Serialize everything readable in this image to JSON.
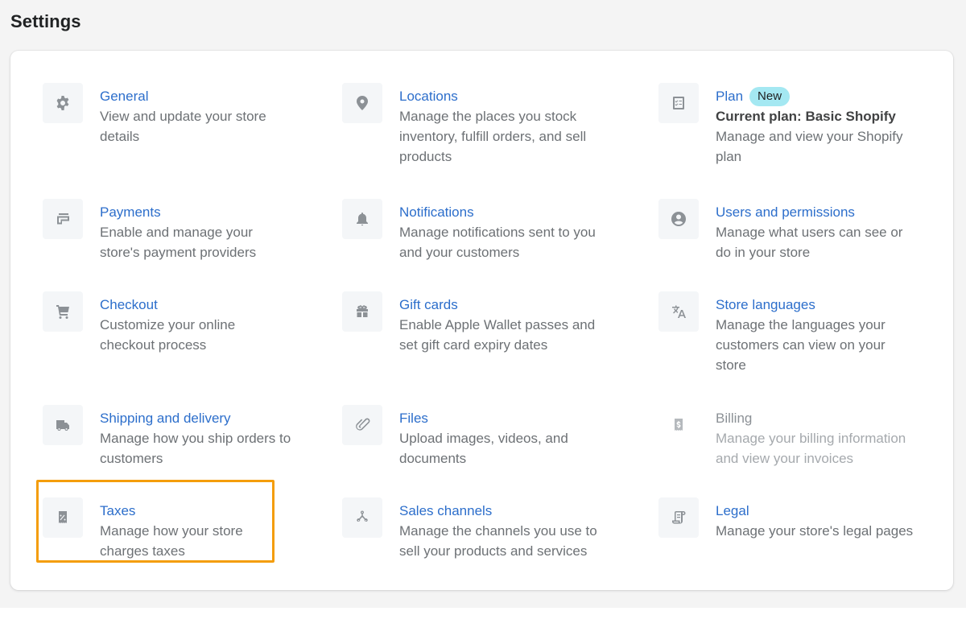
{
  "page": {
    "title": "Settings"
  },
  "highlight": {
    "target": "taxes",
    "color": "#f49d0c"
  },
  "colors": {
    "link": "#2c6ecb",
    "badge_bg": "#a4e8f2",
    "icon": "#8c9196"
  },
  "settings": {
    "general": {
      "icon": "gear-icon",
      "title": "General",
      "description": "View and update your store details"
    },
    "locations": {
      "icon": "location-pin-icon",
      "title": "Locations",
      "description": "Manage the places you stock inventory, fulfill orders, and sell products"
    },
    "plan": {
      "icon": "checklist-icon",
      "title": "Plan",
      "badge": "New",
      "subtitle": "Current plan: Basic Shopify",
      "description": "Manage and view your Shopify plan"
    },
    "payments": {
      "icon": "payment-card-icon",
      "title": "Payments",
      "description": "Enable and manage your store's payment providers"
    },
    "notifications": {
      "icon": "bell-icon",
      "title": "Notifications",
      "description": "Manage notifications sent to you and your customers"
    },
    "users": {
      "icon": "user-circle-icon",
      "title": "Users and permissions",
      "description": "Manage what users can see or do in your store"
    },
    "checkout": {
      "icon": "cart-icon",
      "title": "Checkout",
      "description": "Customize your online checkout process"
    },
    "gift_cards": {
      "icon": "gift-icon",
      "title": "Gift cards",
      "description": "Enable Apple Wallet passes and set gift card expiry dates"
    },
    "languages": {
      "icon": "translate-icon",
      "title": "Store languages",
      "description": "Manage the languages your customers can view on your store"
    },
    "shipping": {
      "icon": "truck-icon",
      "title": "Shipping and delivery",
      "description": "Manage how you ship orders to customers"
    },
    "files": {
      "icon": "paperclip-icon",
      "title": "Files",
      "description": "Upload images, videos, and documents"
    },
    "billing": {
      "icon": "dollar-receipt-icon",
      "title": "Billing",
      "description": "Manage your billing information and view your invoices",
      "disabled": true
    },
    "taxes": {
      "icon": "tax-receipt-icon",
      "title": "Taxes",
      "description": "Manage how your store charges taxes"
    },
    "sales_channels": {
      "icon": "channels-icon",
      "title": "Sales channels",
      "description": "Manage the channels you use to sell your products and services"
    },
    "legal": {
      "icon": "scroll-icon",
      "title": "Legal",
      "description": "Manage your store's legal pages"
    }
  }
}
